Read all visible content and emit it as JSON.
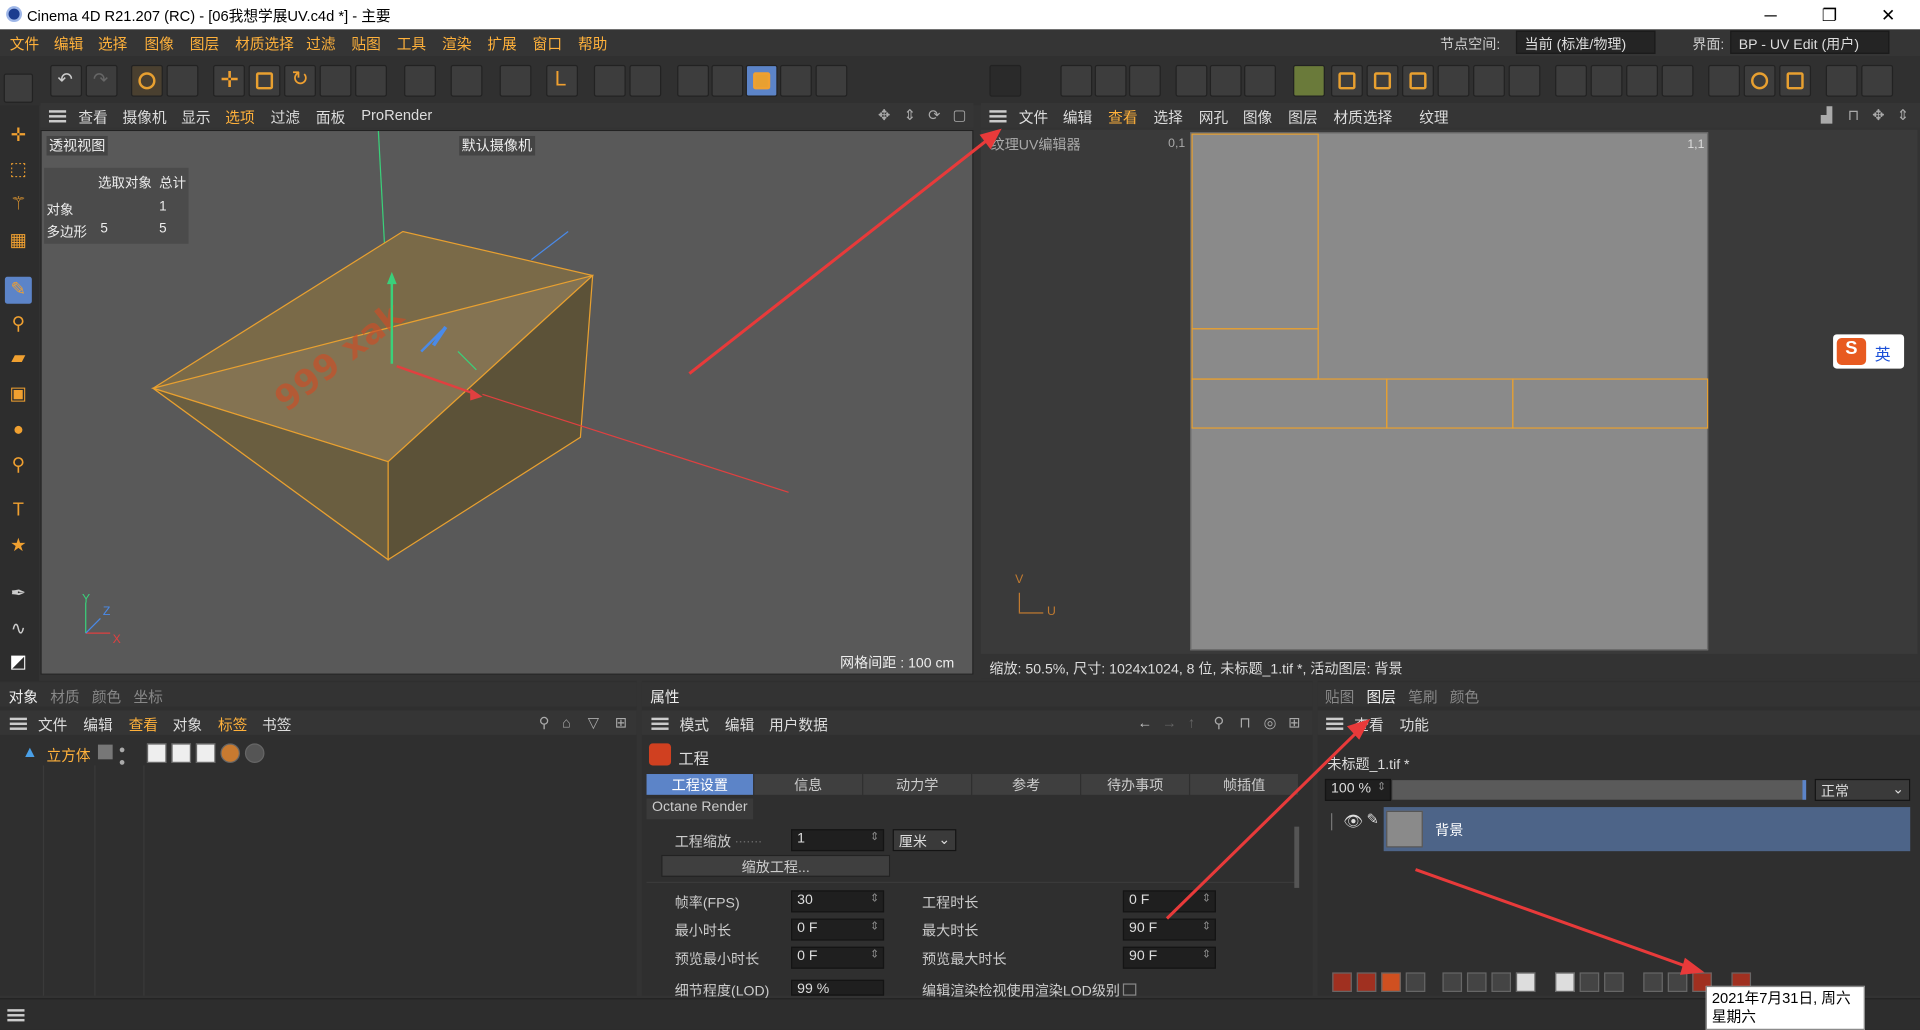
{
  "window": {
    "title": "Cinema 4D R21.207 (RC) - [06我想学展UV.c4d *] - 主要",
    "controls": [
      "─",
      "❐",
      "✕"
    ]
  },
  "menubar": {
    "items": [
      "文件",
      "编辑",
      "选择",
      "图像",
      "图层",
      "材质选择",
      "过滤",
      "贴图",
      "工具",
      "渲染",
      "扩展",
      "窗口",
      "帮助"
    ],
    "node_space_label": "节点空间:",
    "node_space_value": "当前 (标准/物理)",
    "layout_label": "界面:",
    "layout_value": "BP - UV Edit (用户)"
  },
  "viewport": {
    "menu": [
      "查看",
      "摄像机",
      "显示",
      "选项",
      "过滤",
      "面板",
      "ProRender"
    ],
    "name": "透视视图",
    "camera": "默认摄像机",
    "stats": {
      "header": [
        "选取对象",
        "总计"
      ],
      "rows": [
        [
          "对象",
          "",
          "1"
        ],
        [
          "多边形",
          "5",
          "5"
        ]
      ]
    },
    "grid_label": "网格间距 : 100 cm",
    "text_on_object": "999 xak",
    "axis": [
      "Y",
      "Z",
      "X"
    ]
  },
  "uv_editor": {
    "menu": [
      "文件",
      "编辑",
      "查看",
      "选择",
      "网孔",
      "图像",
      "图层",
      "材质选择",
      "纹理"
    ],
    "name": "纹理UV编辑器",
    "corner_tl": "0,1",
    "corner_tr": "1,1",
    "axis": [
      "V",
      "U"
    ],
    "status": "缩放: 50.5%, 尺寸: 1024x1024, 8 位, 未标题_1.tif *, 活动图层: 背景"
  },
  "objects_panel": {
    "tabs": [
      "对象",
      "材质",
      "颜色",
      "坐标"
    ],
    "menu": [
      "文件",
      "编辑",
      "查看",
      "对象",
      "标签",
      "书签"
    ],
    "rows": [
      {
        "name": "立方体"
      }
    ]
  },
  "attributes_panel": {
    "title": "属性",
    "menu": [
      "模式",
      "编辑",
      "用户数据"
    ],
    "section": "工程",
    "tabs": [
      "工程设置",
      "信息",
      "动力学",
      "参考",
      "待办事项",
      "帧插值"
    ],
    "extra_tab": "Octane Render",
    "fields": {
      "scale_label": "工程缩放",
      "scale_value": "1",
      "scale_unit": "厘米",
      "scale_button": "缩放工程...",
      "fps_label": "帧率(FPS)",
      "fps_value": "30",
      "min_label": "最小时长",
      "min_value": "0 F",
      "preview_min_label": "预览最小时长",
      "preview_min_value": "0 F",
      "lod_label": "细节程度(LOD)",
      "lod_value": "99 %",
      "duration_label": "工程时长",
      "duration_value": "0 F",
      "max_label": "最大时长",
      "max_value": "90 F",
      "preview_max_label": "预览最大时长",
      "preview_max_value": "90 F",
      "lod_check_label": "编辑渲染检视使用渲染LOD级别"
    }
  },
  "layers_panel": {
    "tabs": [
      "贴图",
      "图层",
      "笔刷",
      "颜色"
    ],
    "menu": [
      "查看",
      "功能"
    ],
    "file": "未标题_1.tif *",
    "opacity": "100 %",
    "blend": "正常",
    "layer_name": "背景"
  },
  "tooltip": {
    "line1": "2021年7月31日, 周六",
    "line2": "星期六"
  },
  "ime": {
    "label": "英"
  },
  "colors": {
    "accent": "#e8a030",
    "selected": "#5c84c8",
    "arrow": "#e83a3a"
  }
}
